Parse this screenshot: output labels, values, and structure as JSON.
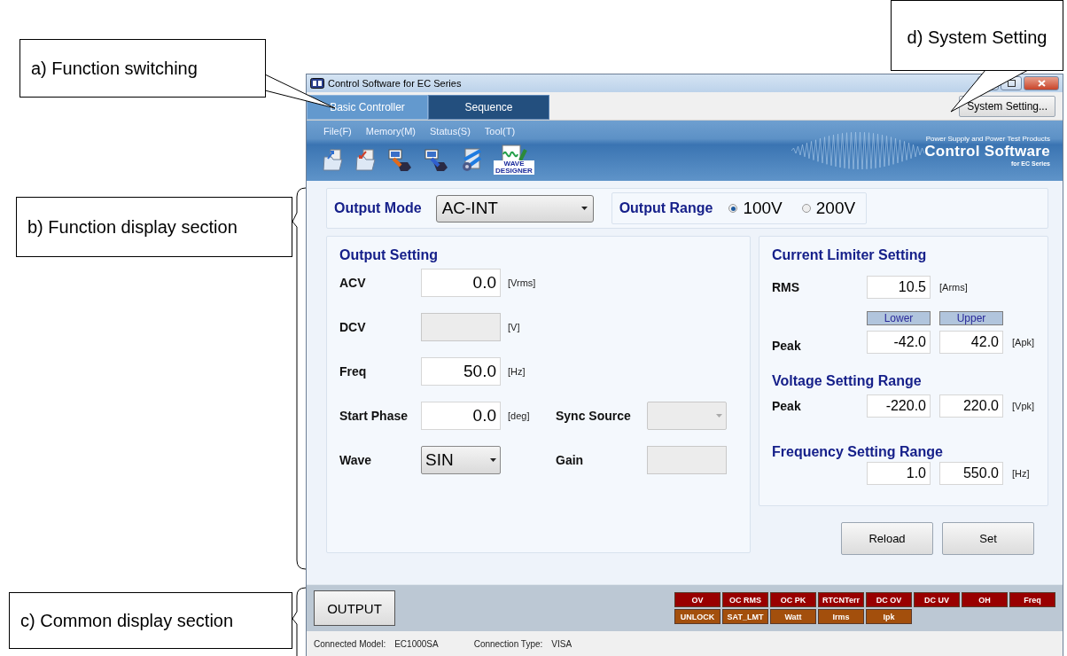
{
  "callouts": [
    {
      "label": "a) Function switching"
    },
    {
      "label": "b) Function display section"
    },
    {
      "label": "c) Common display section"
    },
    {
      "label": "d) System Setting"
    }
  ],
  "window": {
    "title": "Control Software for EC Series"
  },
  "tabs": [
    {
      "label": "Basic Controller",
      "selected": true
    },
    {
      "label": "Sequence",
      "selected": false
    }
  ],
  "system_setting_button": "System Setting...",
  "menu": [
    "File(F)",
    "Memory(M)",
    "Status(S)",
    "Tool(T)"
  ],
  "toolbar": [
    {
      "kind": "open"
    },
    {
      "kind": "save"
    },
    {
      "kind": "send"
    },
    {
      "kind": "receive"
    },
    {
      "kind": "config"
    },
    {
      "kind": "wave",
      "label": "WAVE DESIGNER"
    }
  ],
  "banner": {
    "tagline": "Power Supply and Power Test Products",
    "title": "Control Software",
    "subtitle": "for EC Series"
  },
  "output_mode": {
    "label": "Output Mode",
    "value": "AC-INT"
  },
  "output_range": {
    "label": "Output Range",
    "options": [
      {
        "label": "100V",
        "selected": true
      },
      {
        "label": "200V",
        "selected": false
      }
    ]
  },
  "output_setting": {
    "title": "Output Setting",
    "rows": [
      {
        "label": "ACV",
        "kind": "field",
        "value": "0.0",
        "unit": "[Vrms]",
        "disabled": false
      },
      {
        "label": "DCV",
        "kind": "field",
        "unit": "[V]",
        "disabled": true
      },
      {
        "label": "Freq",
        "kind": "field",
        "value": "50.0",
        "unit": "[Hz]",
        "disabled": false
      },
      {
        "label": "Start Phase",
        "kind": "field",
        "value": "0.0",
        "unit": "[deg]",
        "disabled": false
      },
      {
        "label": "Wave",
        "kind": "dropdown",
        "value": "SIN",
        "disabled": false
      }
    ],
    "side_fields": [
      {
        "label": "Sync Source",
        "kind": "dropdown",
        "disabled": true
      },
      {
        "label": "Gain",
        "kind": "field",
        "disabled": true
      }
    ]
  },
  "current_limiter": {
    "title": "Current Limiter Setting",
    "rms": {
      "label": "RMS",
      "value": "10.5",
      "unit": "[Arms]"
    },
    "column_headers": [
      "Lower",
      "Upper"
    ],
    "peak": {
      "label": "Peak",
      "lower": "-42.0",
      "upper": "42.0",
      "unit": "[Apk]"
    }
  },
  "voltage_range": {
    "title": "Voltage Setting Range",
    "peak": {
      "label": "Peak",
      "lower": "-220.0",
      "upper": "220.0",
      "unit": "[Vpk]"
    }
  },
  "frequency_range": {
    "title": "Frequency Setting Range",
    "lower": "1.0",
    "upper": "550.0",
    "unit": "[Hz]"
  },
  "buttons": [
    "Reload",
    "Set"
  ],
  "output_button": "OUTPUT",
  "alarms": [
    {
      "label": "OV",
      "color": "#990000"
    },
    {
      "label": "OC RMS",
      "color": "#990000"
    },
    {
      "label": "OC PK",
      "color": "#990000"
    },
    {
      "label": "RTCNTerr",
      "color": "#990000"
    },
    {
      "label": "DC OV",
      "color": "#990000"
    },
    {
      "label": "DC UV",
      "color": "#990000"
    },
    {
      "label": "OH",
      "color": "#990000"
    },
    {
      "label": "Freq",
      "color": "#990000"
    },
    {
      "label": "UNLOCK",
      "color": "#a34f0c"
    },
    {
      "label": "SAT_LMT",
      "color": "#a34f0c"
    },
    {
      "label": "Watt",
      "color": "#a34f0c"
    },
    {
      "label": "Irms",
      "color": "#a34f0c"
    },
    {
      "label": "Ipk",
      "color": "#a34f0c"
    }
  ],
  "status_bar": [
    {
      "label": "Connected Model:",
      "value": "EC1000SA"
    },
    {
      "label": "Connection Type:",
      "value": "VISA"
    }
  ]
}
